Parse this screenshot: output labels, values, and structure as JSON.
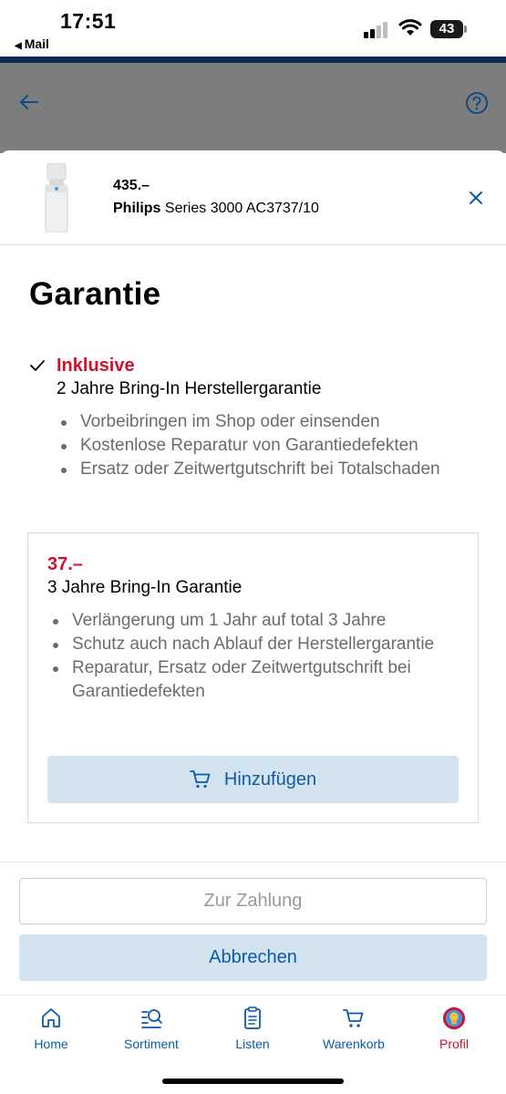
{
  "status_bar": {
    "time": "17:51",
    "back_app": "Mail",
    "battery": "43"
  },
  "product": {
    "price": "435.–",
    "brand": "Philips",
    "model": " Series 3000 AC3737/10"
  },
  "page_title": "Garantie",
  "included": {
    "label": "Inklusive",
    "title": "2 Jahre Bring-In Herstellergarantie",
    "bullets": [
      "Vorbeibringen im Shop oder einsenden",
      "Kostenlose Reparatur von Garantiedefekten",
      "Ersatz oder Zeitwertgutschrift bei Totalschaden"
    ]
  },
  "offer": {
    "price": "37.–",
    "title": "3 Jahre Bring-In Garantie",
    "bullets": [
      "Verlängerung um 1 Jahr auf total 3 Jahre",
      "Schutz auch nach Ablauf der Herstellergarantie",
      "Reparatur, Ersatz oder Zeitwertgutschrift bei Garantiedefekten"
    ],
    "add_label": "Hinzufügen"
  },
  "actions": {
    "pay_label": "Zur Zahlung",
    "cancel_label": "Abbrechen"
  },
  "nav": {
    "items": [
      {
        "label": "Home",
        "icon": "home-icon"
      },
      {
        "label": "Sortiment",
        "icon": "search-list-icon"
      },
      {
        "label": "Listen",
        "icon": "clipboard-icon"
      },
      {
        "label": "Warenkorb",
        "icon": "cart-icon"
      },
      {
        "label": "Profil",
        "icon": "profile-avatar-icon"
      }
    ],
    "active": "Profil"
  },
  "colors": {
    "accent_red": "#d0112b",
    "link_blue": "#0d5aa6",
    "button_bg": "#d3e3f0",
    "header_navy": "#0c2a52"
  }
}
